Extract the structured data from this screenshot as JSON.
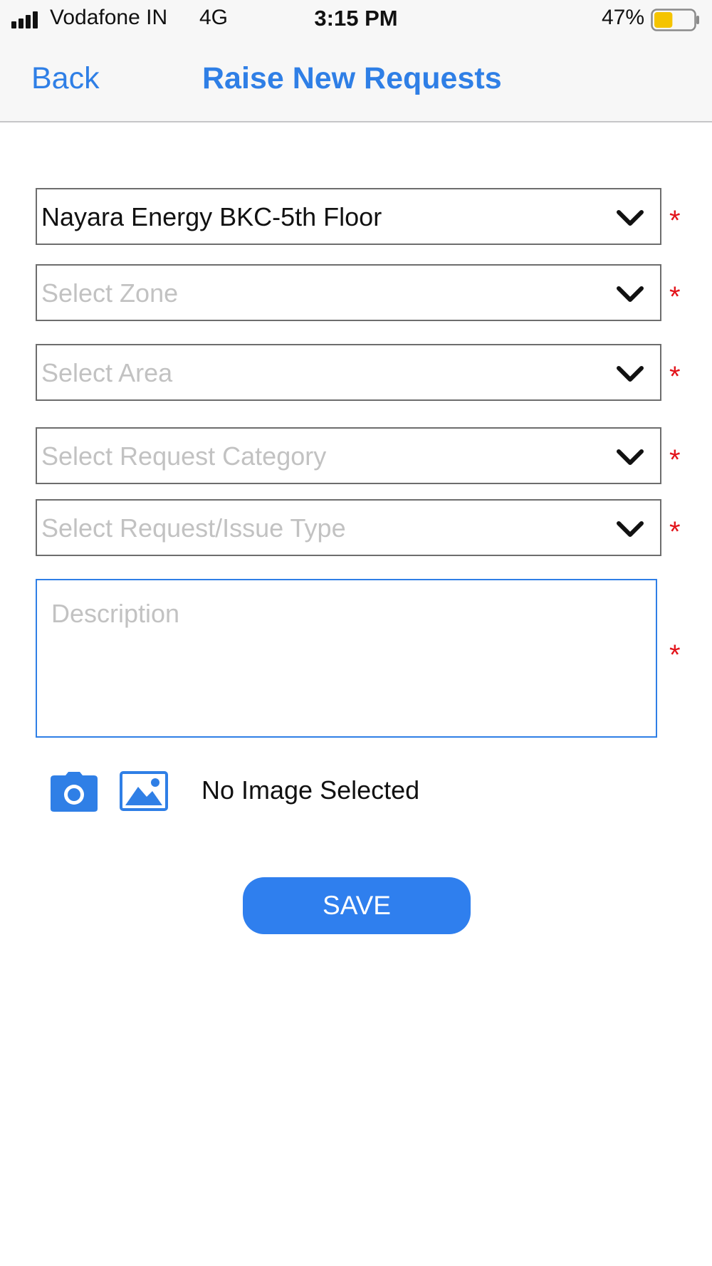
{
  "status_bar": {
    "carrier": "Vodafone IN",
    "network": "4G",
    "time": "3:15 PM",
    "battery_percent": "47%",
    "battery_level": 0.47,
    "battery_color": "#f5c400",
    "signal_icon": "signal-bars-icon",
    "battery_icon": "battery-icon"
  },
  "nav": {
    "back_label": "Back",
    "title": "Raise New Requests"
  },
  "form": {
    "location": {
      "value": "Nayara Energy BKC-5th Floor",
      "required_mark": "*"
    },
    "zone": {
      "placeholder": "Select Zone",
      "required_mark": "*"
    },
    "area": {
      "placeholder": "Select Area",
      "required_mark": "*"
    },
    "request_category": {
      "placeholder": "Select Request Category",
      "required_mark": "*"
    },
    "request_type": {
      "placeholder": "Select Request/Issue Type",
      "required_mark": "*"
    },
    "description": {
      "placeholder": "Description",
      "required_mark": "*"
    },
    "dropdown_icon": "chevron-down-icon",
    "camera_icon": "camera-icon",
    "gallery_icon": "image-icon",
    "image_status": "No Image Selected",
    "save_label": "SAVE"
  },
  "colors": {
    "accent": "#2f7fe6",
    "required": "#e3141b",
    "save_button": "#2f7fee"
  }
}
